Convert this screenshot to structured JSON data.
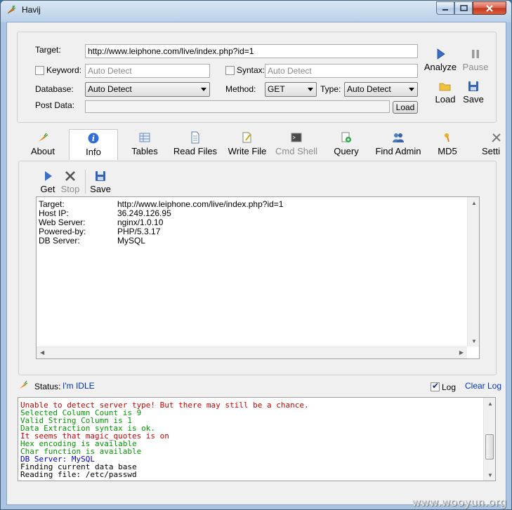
{
  "window": {
    "title": "Havij"
  },
  "form": {
    "target_label": "Target:",
    "target_value": "http://www.leiphone.com/live/index.php?id=1",
    "keyword_label": "Keyword:",
    "keyword_placeholder": "Auto Detect",
    "syntax_label": "Syntax:",
    "syntax_placeholder": "Auto Detect",
    "database_label": "Database:",
    "database_value": "Auto Detect",
    "method_label": "Method:",
    "method_value": "GET",
    "type_label": "Type:",
    "type_value": "Auto Detect",
    "postdata_label": "Post Data:",
    "postdata_value": "",
    "load_button": "Load"
  },
  "actions": {
    "analyze": "Analyze",
    "pause": "Pause",
    "load": "Load",
    "save": "Save"
  },
  "tabs": [
    {
      "label": "About"
    },
    {
      "label": "Info",
      "active": true
    },
    {
      "label": "Tables"
    },
    {
      "label": "Read Files"
    },
    {
      "label": "Write File"
    },
    {
      "label": "Cmd Shell",
      "disabled": true
    },
    {
      "label": "Query"
    },
    {
      "label": "Find Admin"
    },
    {
      "label": "MD5"
    },
    {
      "label": "Setti"
    }
  ],
  "info_toolbar": {
    "get": "Get",
    "stop": "Stop",
    "save": "Save"
  },
  "info": {
    "rows": [
      {
        "key": "Target:",
        "value": "http://www.leiphone.com/live/index.php?id=1"
      },
      {
        "key": "Host IP:",
        "value": "36.249.126.95"
      },
      {
        "key": "Web Server:",
        "value": "nginx/1.0.10"
      },
      {
        "key": "Powered-by:",
        "value": "PHP/5.3.17"
      },
      {
        "key": "DB Server:",
        "value": "MySQL"
      }
    ]
  },
  "status": {
    "label": "Status:",
    "value": "I'm IDLE",
    "log_label": "Log",
    "log_checked": true,
    "clear_log": "Clear Log"
  },
  "log": {
    "lines": [
      {
        "text": "Unable to detect server type! But there may still be a chance.",
        "color": "#cc0000"
      },
      {
        "text": "Selected Column Count is 9",
        "color": "#009900"
      },
      {
        "text": "Valid String Column is 1",
        "color": "#009900"
      },
      {
        "text": "Data Extraction syntax is ok.",
        "color": "#009900"
      },
      {
        "text": "It seems that magic_quotes is on",
        "color": "#cc0000"
      },
      {
        "text": "Hex encoding is available",
        "color": "#009900"
      },
      {
        "text": "Char function is available",
        "color": "#009900"
      },
      {
        "text": "DB Server: MySQL",
        "color": "#0000cc"
      },
      {
        "text": "Finding current data base",
        "color": "#000000"
      },
      {
        "text": "Reading file: /etc/passwd",
        "color": "#000000"
      }
    ]
  },
  "watermark": "www.wooyun.org"
}
